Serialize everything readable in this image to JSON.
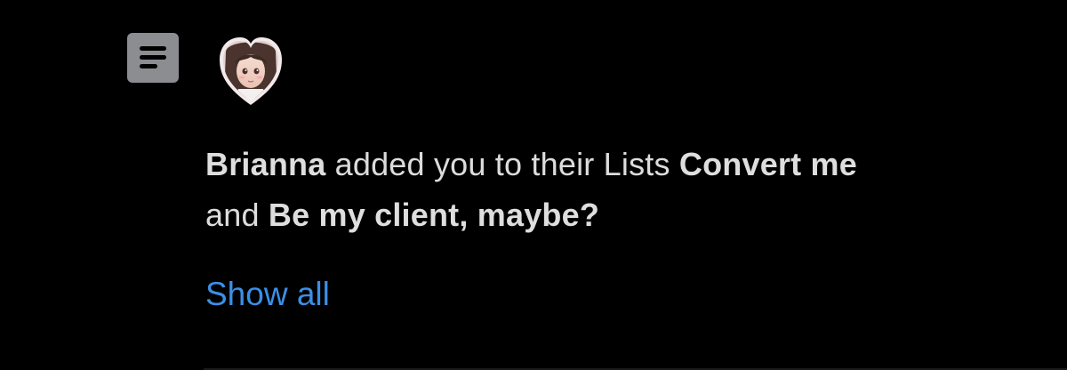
{
  "notification": {
    "icon": "list-icon",
    "avatar_icon": "heart-avatar-icon",
    "user_name": "Brianna",
    "text_added": " added you to their Lists ",
    "list_one": "Convert me",
    "text_and": "and ",
    "list_two": "Be my client, maybe?",
    "show_all": "Show all",
    "colors": {
      "background": "#000000",
      "text": "#dcdcdc",
      "link": "#3b8fe6",
      "icon_bg": "#8b8d90"
    }
  }
}
